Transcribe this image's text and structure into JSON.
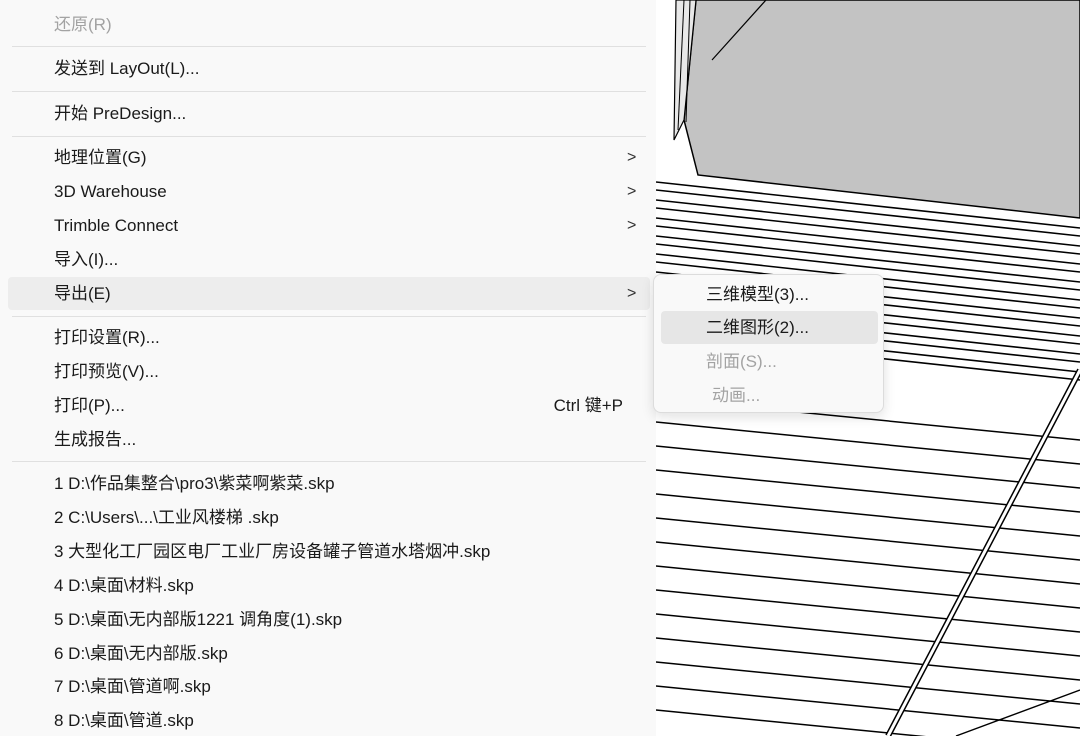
{
  "menu": {
    "items": [
      {
        "label": "还原(R)",
        "disabled": true
      },
      {
        "label": "发送到 LayOut(L)..."
      },
      {
        "label": "开始 PreDesign..."
      },
      {
        "label": "地理位置(G)",
        "arrow": ">"
      },
      {
        "label": "3D Warehouse",
        "arrow": ">"
      },
      {
        "label": "Trimble Connect",
        "arrow": ">"
      },
      {
        "label": "导入(I)..."
      },
      {
        "label": "导出(E)",
        "arrow": ">",
        "highlighted": true
      },
      {
        "label": "打印设置(R)..."
      },
      {
        "label": "打印预览(V)..."
      },
      {
        "label": "打印(P)...",
        "shortcut": "Ctrl 键+P"
      },
      {
        "label": "生成报告..."
      },
      {
        "label": "1 D:\\作品集整合\\pro3\\紫菜啊紫菜.skp"
      },
      {
        "label": "2 C:\\Users\\...\\工业风楼梯 .skp"
      },
      {
        "label": "3 大型化工厂园区电厂工业厂房设备罐子管道水塔烟冲.skp"
      },
      {
        "label": "4 D:\\桌面\\材料.skp"
      },
      {
        "label": "5 D:\\桌面\\无内部版1221 调角度(1).skp"
      },
      {
        "label": "6 D:\\桌面\\无内部版.skp"
      },
      {
        "label": "7 D:\\桌面\\管道啊.skp"
      },
      {
        "label": "8 D:\\桌面\\管道.skp"
      }
    ]
  },
  "export_submenu": {
    "items": [
      {
        "label": "三维模型(3)..."
      },
      {
        "label": "二维图形(2)...",
        "highlighted": true
      },
      {
        "label": "剖面(S)...",
        "disabled": true
      },
      {
        "label": "动画...",
        "disabled": true
      }
    ]
  },
  "icons": {
    "submenu_arrow": "chevron-right-icon"
  },
  "colors": {
    "menu_bg": "#f9f9f9",
    "highlight": "#ededed",
    "disabled_text": "#a3a3a3",
    "separator": "#e0e0e0"
  }
}
